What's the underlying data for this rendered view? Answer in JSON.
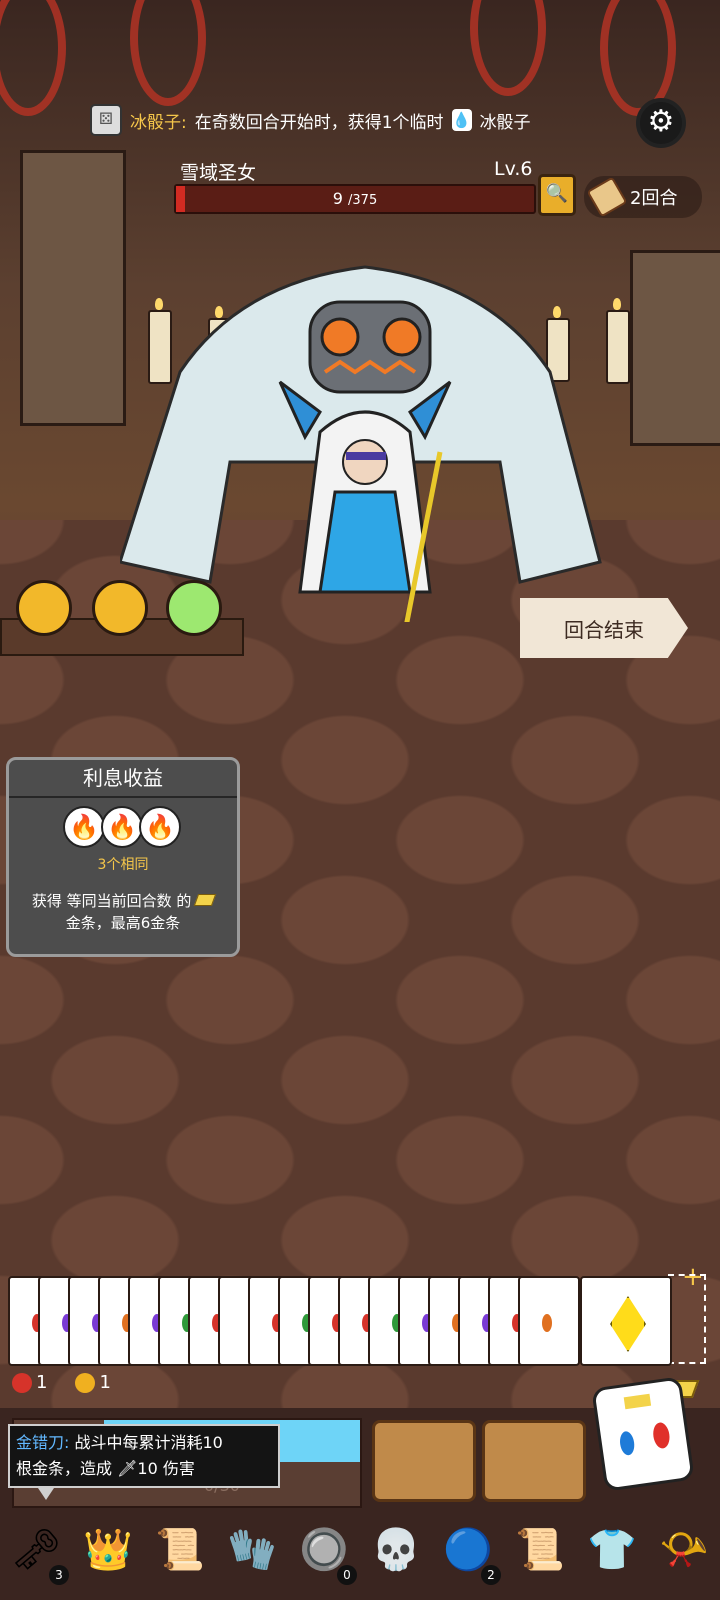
{
  "skill": {
    "name": "冰骰子",
    "colon": ":",
    "text": "在奇数回合开始时，获得1个临时",
    "item": "冰骰子",
    "water_glyph": "💧"
  },
  "boss": {
    "name": "雪域圣女",
    "level": "Lv.6",
    "hp_current": "9",
    "hp_max": "/375",
    "hp_fraction": 0.024
  },
  "round": {
    "label": "2回合"
  },
  "end_turn": {
    "label": "回合结束"
  },
  "interest": {
    "title": "利息收益",
    "same": "3个相同",
    "desc_line1": "获得 等同当前回合数 的",
    "desc_line2": "金条，最高6金条"
  },
  "stats": {
    "a": "1",
    "b": "1"
  },
  "mana": {
    "text": "0/30"
  },
  "tooltip": {
    "name": "金错刀",
    "colon": ":",
    "line1": "战斗中每累计消耗10",
    "line2a": "根金条，造成",
    "line2b": "10 伤害"
  },
  "relics": [
    {
      "name": "golden-key",
      "glyph": "🗝",
      "badge": "3"
    },
    {
      "name": "crown",
      "glyph": "👑",
      "badge": ""
    },
    {
      "name": "scroll",
      "glyph": "📜",
      "badge": ""
    },
    {
      "name": "glove",
      "glyph": "🧤",
      "badge": ""
    },
    {
      "name": "button",
      "glyph": "🔘",
      "badge": "0"
    },
    {
      "name": "skull-helmet",
      "glyph": "💀",
      "badge": ""
    },
    {
      "name": "blue-orb",
      "glyph": "🔵",
      "badge": "2"
    },
    {
      "name": "scroll-2",
      "glyph": "📜",
      "badge": ""
    },
    {
      "name": "shirt",
      "glyph": "👕",
      "badge": ""
    },
    {
      "name": "horn",
      "glyph": "📯",
      "badge": ""
    }
  ],
  "hand_gem_colors": [
    "#d6332a",
    "#7a3bd6",
    "#7a3bd6",
    "#e07020",
    "#7a3bd6",
    "#2f9a3a",
    "#d6332a",
    "#ffffff",
    "#d6332a",
    "#2f9a3a",
    "#d6332a",
    "#d6332a",
    "#2f9a3a",
    "#7a3bd6",
    "#e07020",
    "#7a3bd6",
    "#d6332a",
    "#e07020"
  ],
  "colors": {
    "accent": "#f5c64a",
    "hp": "#d22b22",
    "mana": "#6ed4f7"
  }
}
